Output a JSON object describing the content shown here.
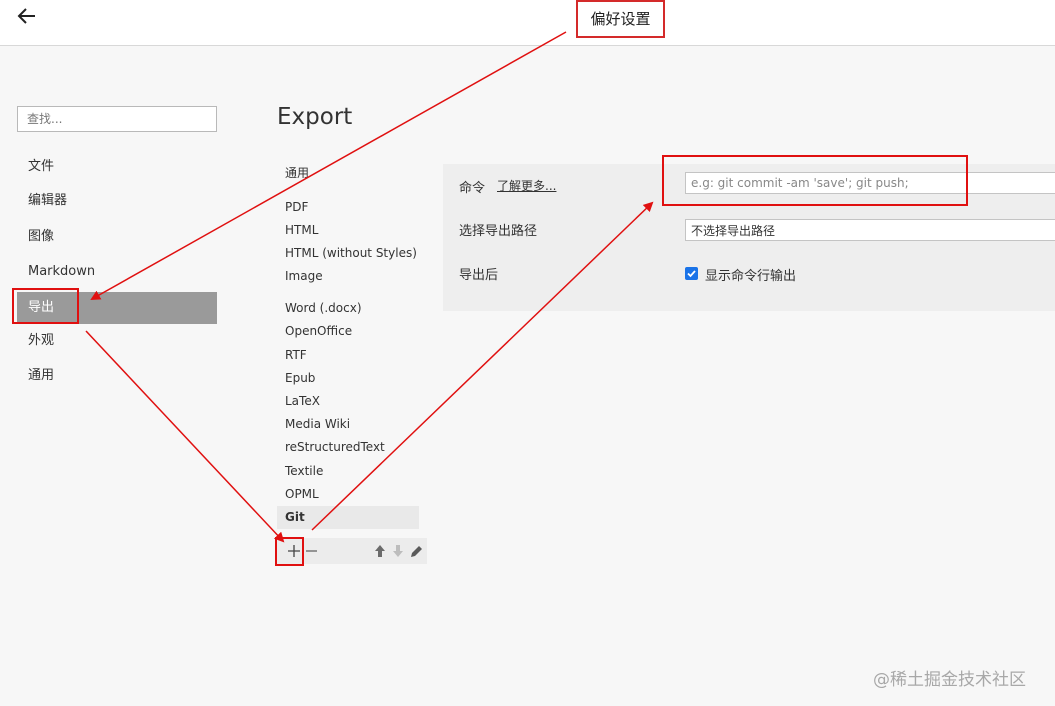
{
  "annotation": {
    "title": "偏好设置"
  },
  "search": {
    "placeholder": "查找..."
  },
  "sidebar": {
    "items": [
      {
        "label": "文件"
      },
      {
        "label": "编辑器"
      },
      {
        "label": "图像"
      },
      {
        "label": "Markdown"
      },
      {
        "label": "导出",
        "active": true
      },
      {
        "label": "外观"
      },
      {
        "label": "通用"
      }
    ]
  },
  "page": {
    "title": "Export"
  },
  "export_list": {
    "items": [
      {
        "label": "通用"
      },
      {
        "label": "PDF"
      },
      {
        "label": "HTML"
      },
      {
        "label": "HTML (without Styles)"
      },
      {
        "label": "Image"
      },
      {
        "label": "Word (.docx)"
      },
      {
        "label": "OpenOffice"
      },
      {
        "label": "RTF"
      },
      {
        "label": "Epub"
      },
      {
        "label": "LaTeX"
      },
      {
        "label": "Media Wiki"
      },
      {
        "label": "reStructuredText"
      },
      {
        "label": "Textile"
      },
      {
        "label": "OPML"
      },
      {
        "label": "Git",
        "selected": true
      }
    ]
  },
  "toolbar": {
    "add_icon": "plus-icon",
    "remove_icon": "minus-icon",
    "up_icon": "arrow-up-icon",
    "down_icon": "arrow-down-icon",
    "edit_icon": "pencil-icon"
  },
  "settings": {
    "command_label": "命令",
    "learn_more": "了解更多...",
    "command_placeholder": "e.g: git commit -am 'save'; git push;",
    "output_path_label": "选择导出路径",
    "output_path_value": "不选择导出路径",
    "after_export_label": "导出后",
    "show_output_label": "显示命令行输出",
    "show_output_checked": true
  },
  "colors": {
    "accent": "#1a73e8",
    "annotation_red": "#e01010",
    "active_nav": "#9a9a9a"
  },
  "watermark": "@稀土掘金技术社区"
}
